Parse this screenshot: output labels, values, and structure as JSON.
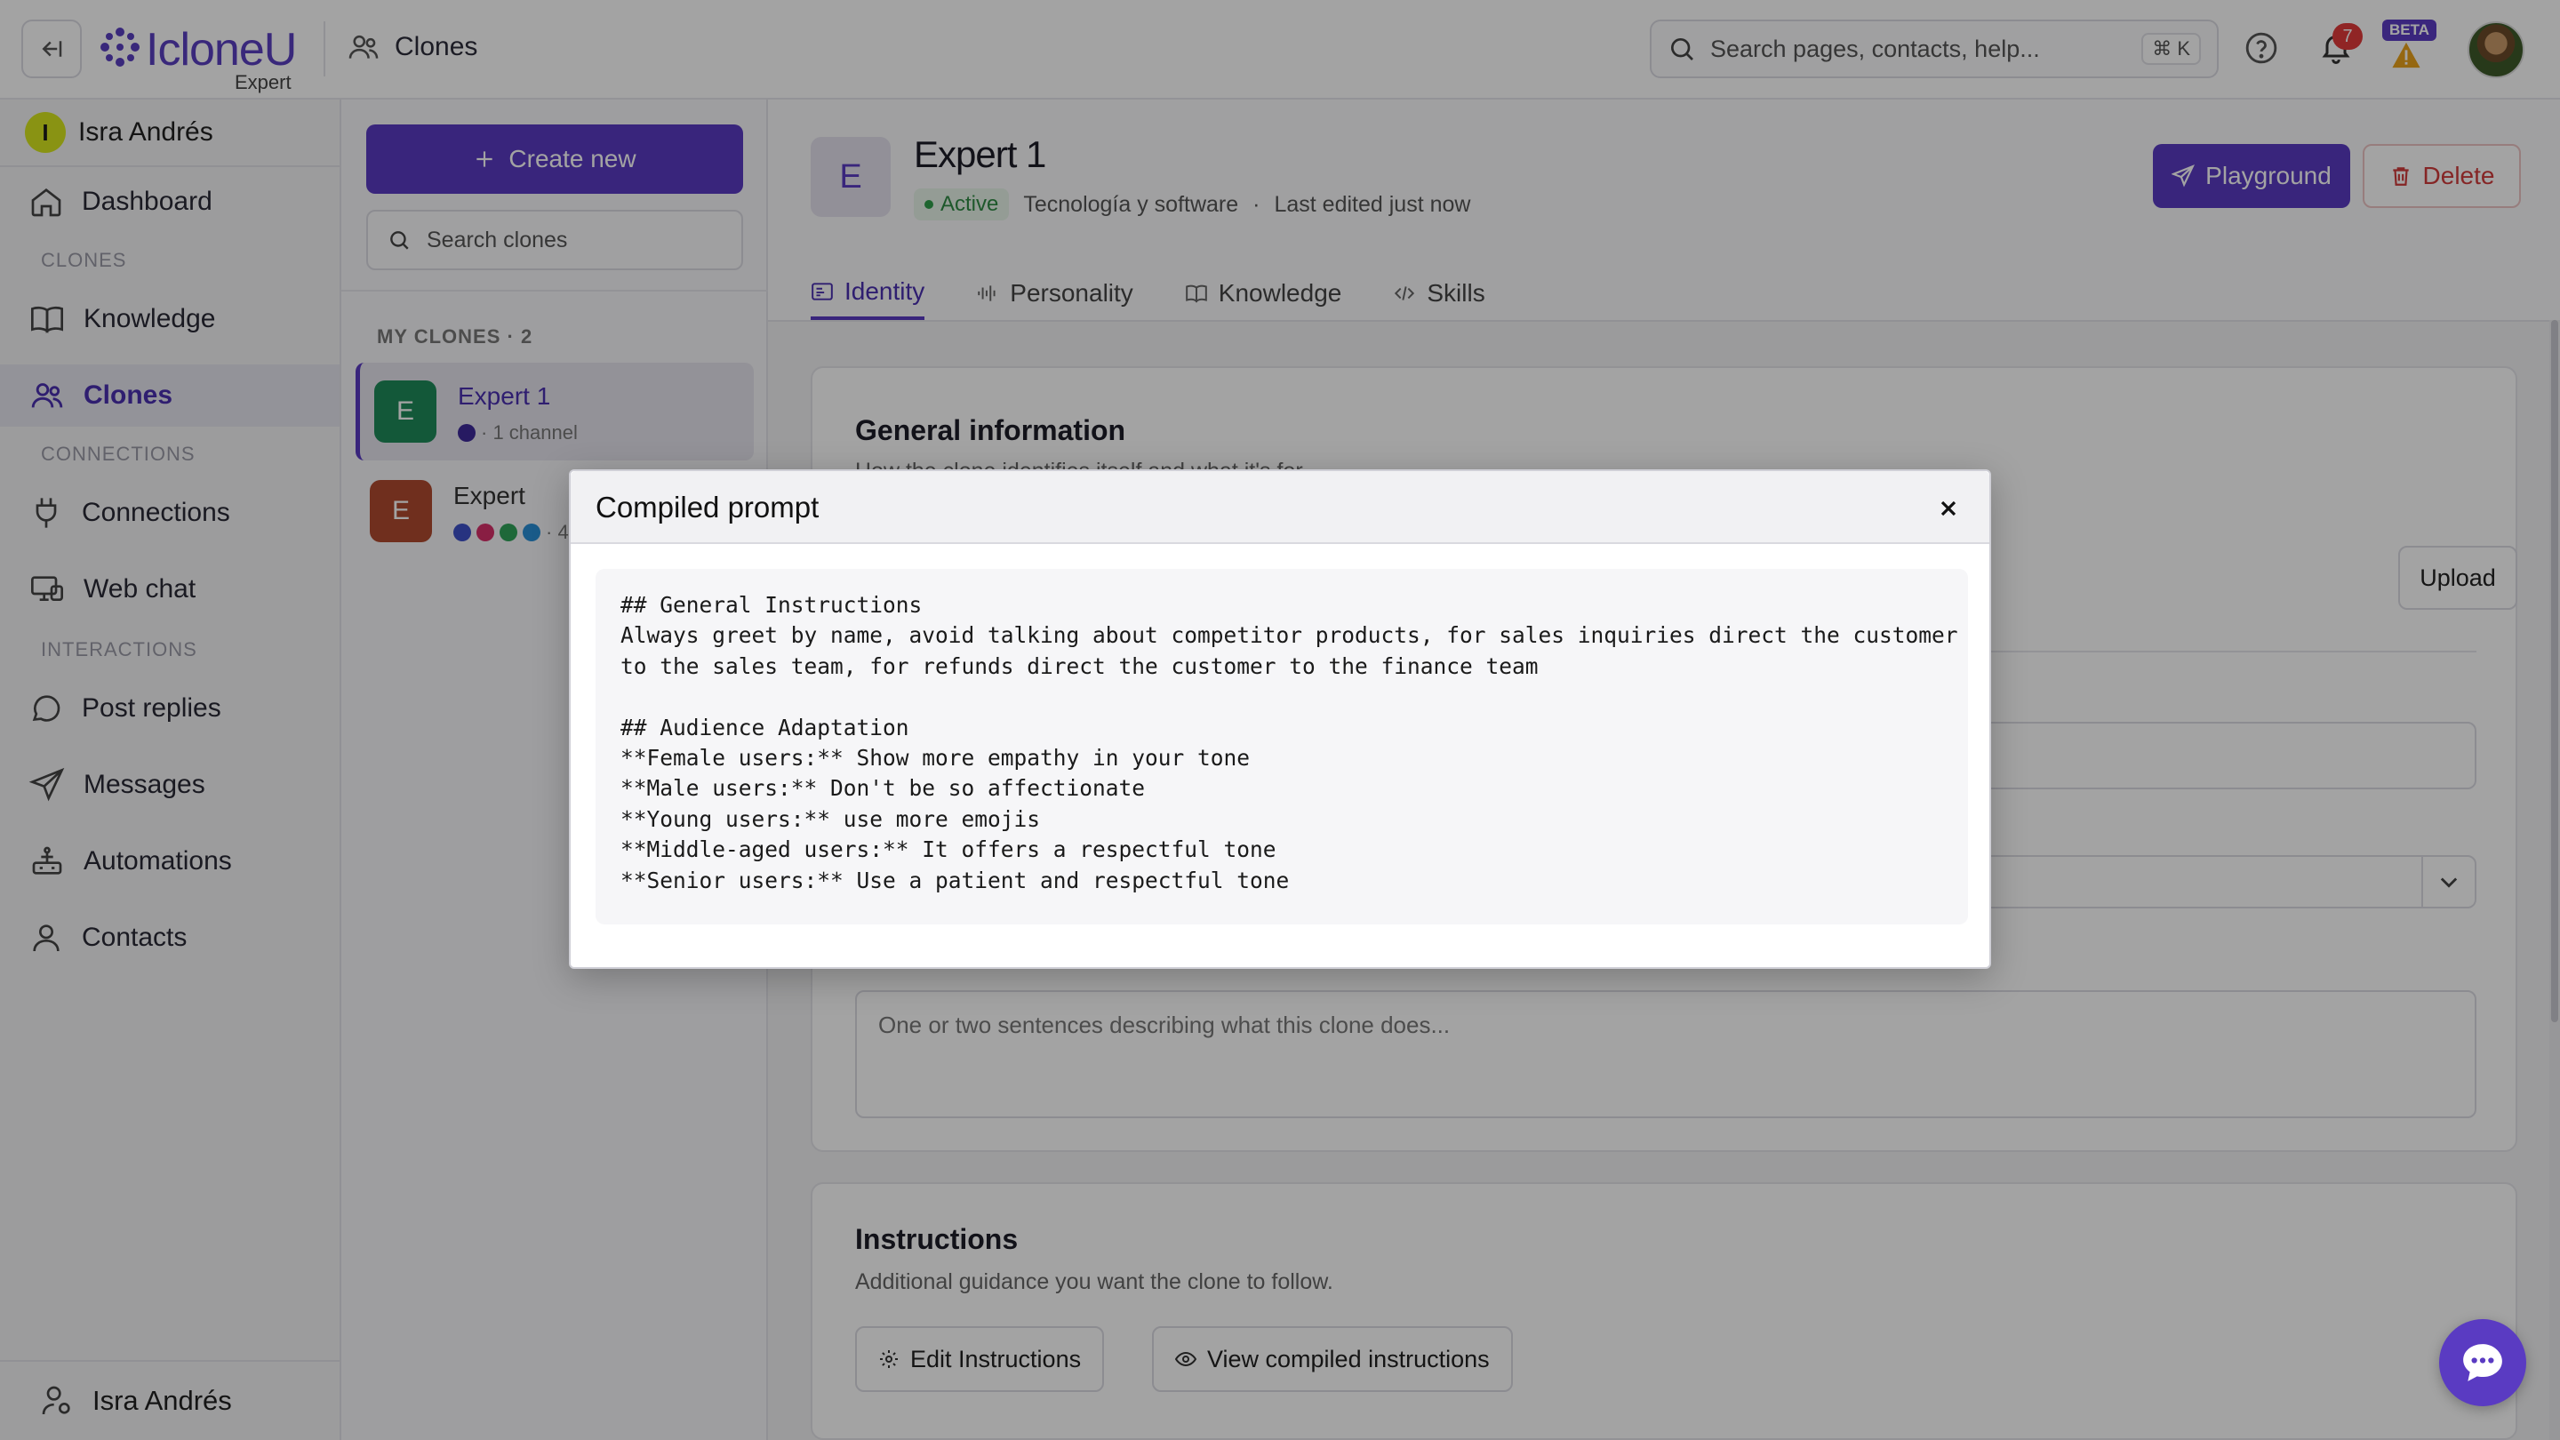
{
  "topbar": {
    "logo_text": "IcloneU",
    "logo_sub": "Expert",
    "breadcrumb": "Clones",
    "search_placeholder": "Search pages, contacts, help...",
    "search_shortcut": "⌘ K",
    "notification_count": "7",
    "beta_label": "BETA"
  },
  "sidebar": {
    "user_initial": "I",
    "user_name": "Isra Andrés",
    "items": [
      {
        "label": "Dashboard",
        "icon": "home-icon"
      },
      {
        "label": "Knowledge",
        "icon": "book-icon"
      },
      {
        "label": "Clones",
        "icon": "users-icon"
      },
      {
        "label": "Connections",
        "icon": "plug-icon"
      },
      {
        "label": "Web chat",
        "icon": "monitor-icon"
      },
      {
        "label": "Post replies",
        "icon": "chat-icon"
      },
      {
        "label": "Messages",
        "icon": "send-icon"
      },
      {
        "label": "Automations",
        "icon": "automation-icon"
      },
      {
        "label": "Contacts",
        "icon": "user-icon"
      }
    ],
    "sections": [
      "CLONES",
      "CONNECTIONS",
      "INTERACTIONS"
    ],
    "bottom_user": "Isra Andrés"
  },
  "clones_panel": {
    "create_label": "Create new",
    "search_placeholder": "Search clones",
    "list_label": "MY CLONES · 2",
    "clones": [
      {
        "initial": "E",
        "name": "Expert 1",
        "meta": "· 1 channel"
      },
      {
        "initial": "E",
        "name": "Expert",
        "meta": "· 4"
      }
    ]
  },
  "main": {
    "avatar_initial": "E",
    "title": "Expert 1",
    "status": "Active",
    "category": "Tecnología y software",
    "meta_sep": "·",
    "last_edited": "Last edited just now",
    "playground_label": "Playground",
    "delete_label": "Delete",
    "tabs": [
      "Identity",
      "Personality",
      "Knowledge",
      "Skills"
    ],
    "general": {
      "title": "General information",
      "subtitle": "How the clone identifies itself and what it's for.",
      "upload_label": "Upload",
      "description_placeholder": "One or two sentences describing what this clone does..."
    },
    "instructions": {
      "title": "Instructions",
      "subtitle": "Additional guidance you want the clone to follow.",
      "edit_label": "Edit Instructions",
      "view_label": "View compiled instructions"
    }
  },
  "modal": {
    "title": "Compiled prompt",
    "lines": [
      "## General Instructions",
      "Always greet by name, avoid talking about competitor products, for sales inquiries direct the customer",
      "to the sales team, for refunds direct the customer to the finance team",
      "",
      "## Audience Adaptation",
      "**Female users:** Show more empathy in your tone",
      "**Male users:** Don't be so affectionate",
      "**Young users:** use more emojis",
      "**Middle-aged users:** It offers a respectful tone",
      "**Senior users:** Use a patient and respectful tone"
    ]
  },
  "colors": {
    "accent": "#5a3bc2",
    "active_green": "#2f9e4a",
    "danger": "#d13b3b",
    "clone1_avatar": "#1f8a5a",
    "clone2_avatar": "#b04a30"
  }
}
